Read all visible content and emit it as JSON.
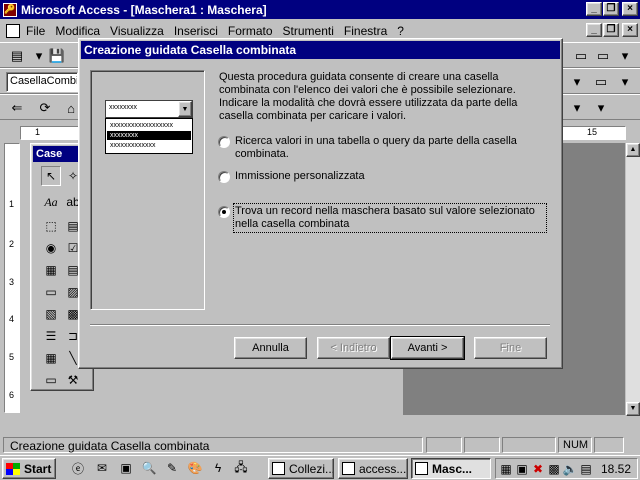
{
  "window": {
    "title": "Microsoft Access - [Maschera1 : Maschera]"
  },
  "menu": {
    "items": [
      {
        "label": "File",
        "key": "F"
      },
      {
        "label": "Modifica",
        "key": "M"
      },
      {
        "label": "Visualizza",
        "key": "V"
      },
      {
        "label": "Inserisci",
        "key": "I"
      },
      {
        "label": "Formato",
        "key": "o"
      },
      {
        "label": "Strumenti",
        "key": "S"
      },
      {
        "label": "Finestra",
        "key": "n"
      },
      {
        "label": "?",
        "key": "?"
      }
    ]
  },
  "toolbar": {
    "object_combo": "CasellaCombin"
  },
  "ruler": {
    "vertical_marks": [
      "1",
      "2",
      "3",
      "4",
      "5",
      "6"
    ],
    "horizontal_mark_left": "1",
    "horizontal_mark_right": "15"
  },
  "toolbox": {
    "title": "Case"
  },
  "dialog": {
    "title": "Creazione guidata Casella combinata",
    "intro": "Questa procedura guidata consente di creare una casella combinata con l'elenco dei valori che è possibile selezionare. Indicare la modalità che dovrà essere utilizzata da parte della casella combinata per caricare i valori.",
    "preview_combo_text": "xxxxxxxx",
    "preview_rows": [
      "xxxxxxxxxxxxxxxxxx",
      "xxxxxxxx",
      "xxxxxxxxxxxxx"
    ],
    "options": [
      {
        "label": "Ricerca valori in una tabella o query da parte della casella combinata.",
        "selected": false
      },
      {
        "label": "Immissione personalizzata",
        "selected": false
      },
      {
        "label": "Trova un record nella maschera basato sul valore selezionato nella casella combinata",
        "selected": true
      }
    ],
    "buttons": {
      "cancel": "Annulla",
      "back": "< Indietro",
      "next": "Avanti >",
      "finish": "Fine"
    }
  },
  "statusbar": {
    "text": "Creazione guidata Casella combinata",
    "num": "NUM"
  },
  "taskbar": {
    "start": "Start",
    "tasks": [
      "Collezi...",
      "access...",
      "Masc..."
    ],
    "clock": "18.52"
  }
}
